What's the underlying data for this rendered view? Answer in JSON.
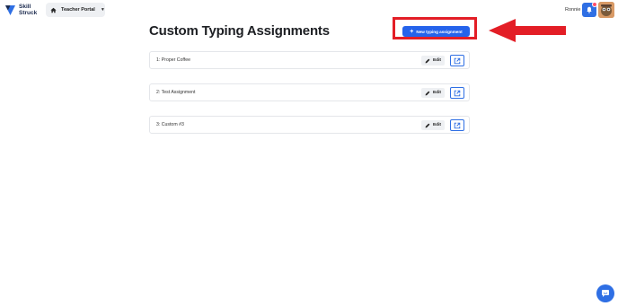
{
  "header": {
    "logo": {
      "line1": "Skill",
      "line2": "Struck",
      "icon": "skill-struck-logo-icon"
    },
    "portal": {
      "label": "Teacher Portal",
      "icon": "home-icon"
    },
    "user_name": "Ronnie",
    "notifications": {
      "icon": "bell-icon",
      "has_badge": true
    }
  },
  "main": {
    "title": "Custom Typing Assignments",
    "new_button": {
      "label": "New typing assignment",
      "icon": "plus-icon"
    },
    "assignments": [
      {
        "name": "1: Proper Coffee",
        "edit_label": "Edit"
      },
      {
        "name": "2: Test Assignment",
        "edit_label": "Edit"
      },
      {
        "name": "3: Custom #3",
        "edit_label": "Edit"
      }
    ]
  },
  "annotation": {
    "highlight_color": "#e31e26",
    "arrow_color": "#e31e26"
  },
  "colors": {
    "accent": "#2563eb",
    "button_bg": "#eef0f3"
  },
  "chat": {
    "icon": "chat-icon"
  }
}
